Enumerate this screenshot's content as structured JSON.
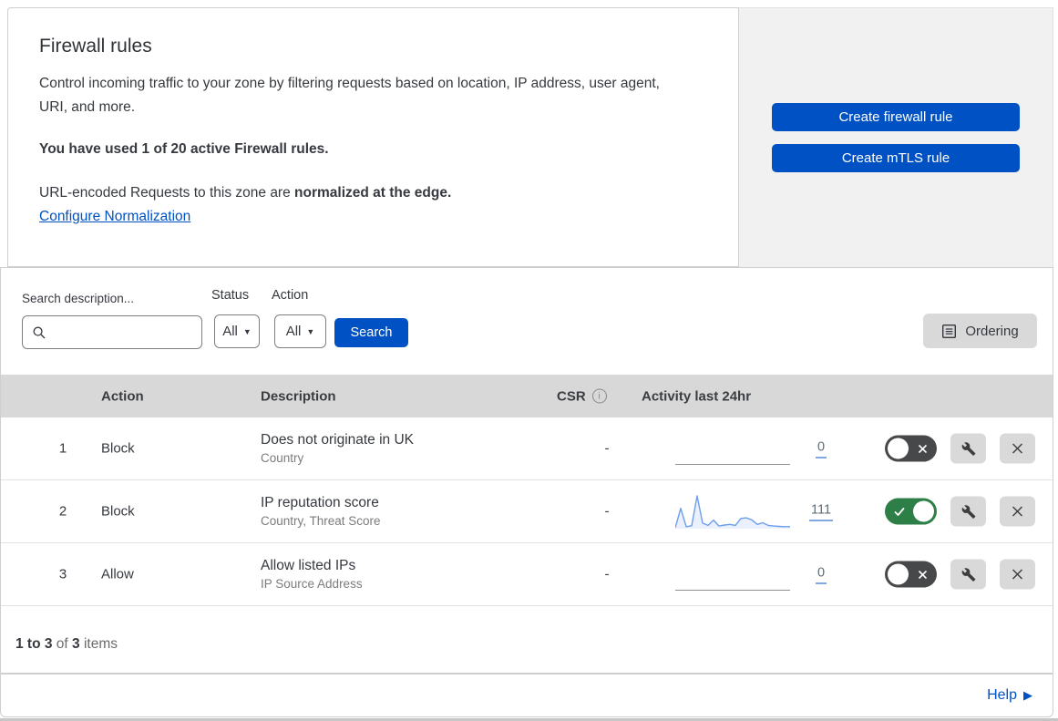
{
  "header": {
    "title": "Firewall rules",
    "description": "Control incoming traffic to your zone by filtering requests based on location, IP address, user agent, URI, and more.",
    "usage_notice": "You have used 1 of 20 active Firewall rules.",
    "normalization_prefix": "URL-encoded Requests to this zone are ",
    "normalization_bold": "normalized at the edge.",
    "normalization_link": "Configure Normalization"
  },
  "actions_panel": {
    "create_firewall_rule_label": "Create firewall rule",
    "create_mtls_rule_label": "Create mTLS rule"
  },
  "filters": {
    "search_label": "Search description...",
    "status_label": "Status",
    "status_value": "All",
    "action_label": "Action",
    "action_value": "All",
    "search_button_label": "Search",
    "ordering_button_label": "Ordering"
  },
  "table": {
    "columns": {
      "action": "Action",
      "description": "Description",
      "csr": "CSR",
      "activity": "Activity last 24hr"
    },
    "rows": [
      {
        "priority": "1",
        "action": "Block",
        "description": "Does not originate in UK",
        "fields": "Country",
        "csr": "-",
        "activity_count": "0",
        "enabled": false
      },
      {
        "priority": "2",
        "action": "Block",
        "description": "IP reputation score",
        "fields": "Country, Threat Score",
        "csr": "-",
        "activity_count": "111",
        "enabled": true
      },
      {
        "priority": "3",
        "action": "Allow",
        "description": "Allow listed IPs",
        "fields": "IP Source Address",
        "csr": "-",
        "activity_count": "0",
        "enabled": false
      }
    ]
  },
  "footer": {
    "range": "1 to 3",
    "of": " of ",
    "total": "3",
    "items": " items"
  },
  "help": {
    "label": "Help"
  },
  "chart_data": {
    "type": "area",
    "title": "Activity last 24hr sparkline (rule 2: IP reputation score)",
    "x": "last 24 hours, left = oldest",
    "values": [
      3,
      62,
      6,
      9,
      100,
      17,
      10,
      26,
      8,
      11,
      13,
      10,
      31,
      33,
      27,
      13,
      18,
      10,
      8,
      7,
      6,
      6
    ],
    "total_events": 111,
    "ylim": [
      0,
      100
    ],
    "zero_activity_rows": [
      "1",
      "3"
    ]
  },
  "colors": {
    "accent_blue": "#0051c3",
    "toggle_on_green": "#2d7f47",
    "toggle_off_gray": "#47484a",
    "sparkline_blue": "#6d9eeb",
    "table_header_gray": "#d8d8d8",
    "panel_gray": "#f1f1f1",
    "button_gray": "#d9d9d9"
  }
}
